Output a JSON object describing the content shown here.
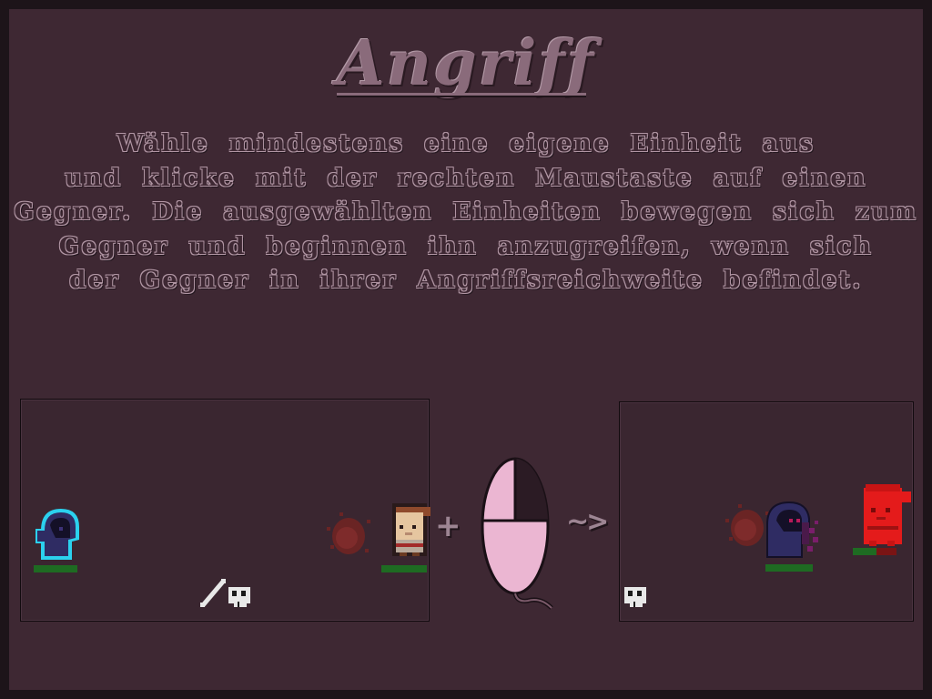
{
  "tutorial": {
    "title": "Angriff",
    "instruction_lines": [
      "Wähle mindestens eine eigene Einheit aus",
      "und klicke mit der rechten Maustaste auf einen",
      "Gegner. Die ausgewählten Einheiten bewegen sich zum",
      "Gegner und beginnen ihn anzugreifen, wenn sich",
      "der Gegner in ihrer Angriffsreichweite befindet."
    ]
  },
  "illustration": {
    "plus_symbol": "+",
    "arrow_symbol": "~>",
    "mouse_highlighted_button": "right",
    "before_panel": {
      "own_unit": "blue hooded reaper (selected)",
      "enemy_unit": "bald villager",
      "own_health": 1.0,
      "enemy_health": 1.0
    },
    "after_panel": {
      "own_unit": "blue hooded reaper (attacking)",
      "enemy_unit": "villager (damaged, red)",
      "own_health": 1.0,
      "enemy_health": 0.55
    }
  },
  "colors": {
    "background": "#3e2833",
    "text_outline": "#b095a3",
    "health_green": "#1e6b22",
    "health_red": "#7a1414",
    "mouse_pink": "#ebb6d2",
    "selection_cyan": "#2bd1ee"
  }
}
